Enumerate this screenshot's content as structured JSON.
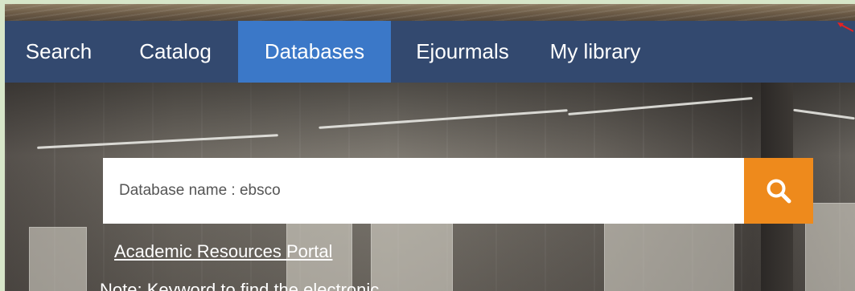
{
  "nav": {
    "items": [
      {
        "label": "Search",
        "active": false
      },
      {
        "label": "Catalog",
        "active": false
      },
      {
        "label": "Databases",
        "active": true
      },
      {
        "label": "Ejourmals",
        "active": false
      },
      {
        "label": "My library",
        "active": false
      }
    ]
  },
  "search": {
    "value": "Database name : ebsco",
    "button_icon": "search-icon"
  },
  "links": {
    "portal": "Academic Resources Portal"
  },
  "note": {
    "text": "Note: Keyword to find the electronic"
  },
  "colors": {
    "nav_bg": "#33496f",
    "nav_active": "#3b78c8",
    "search_button": "#ee8a1c",
    "outer_border": "#d7e6c9"
  }
}
